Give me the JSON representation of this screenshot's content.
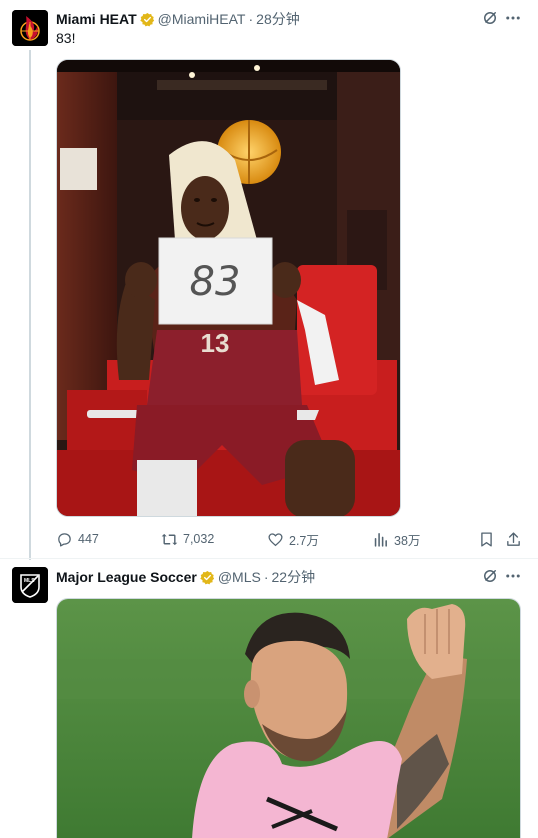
{
  "tweets": [
    {
      "author": "Miami HEAT",
      "handle": "@MiamiHEAT",
      "separator": "·",
      "time": "28分钟",
      "text": "83!",
      "photo_sign_text": "83",
      "jersey_number": "13",
      "avatar_icon": "heat-logo-icon",
      "badge_color": "#e2b719",
      "stats": {
        "replies": "447",
        "reposts": "7,032",
        "likes": "2.7万",
        "views": "38万"
      }
    },
    {
      "author": "Major League Soccer",
      "handle": "@MLS",
      "separator": "·",
      "time": "22分钟",
      "avatar_icon": "mls-logo-icon",
      "avatar_text": "MLS"
    }
  ],
  "colors": {
    "text_primary": "#0f1419",
    "text_secondary": "#536471",
    "heat_red": "#98002e",
    "pitch_green": "#4f8a3e",
    "inter_pink": "#f4b6d2"
  }
}
